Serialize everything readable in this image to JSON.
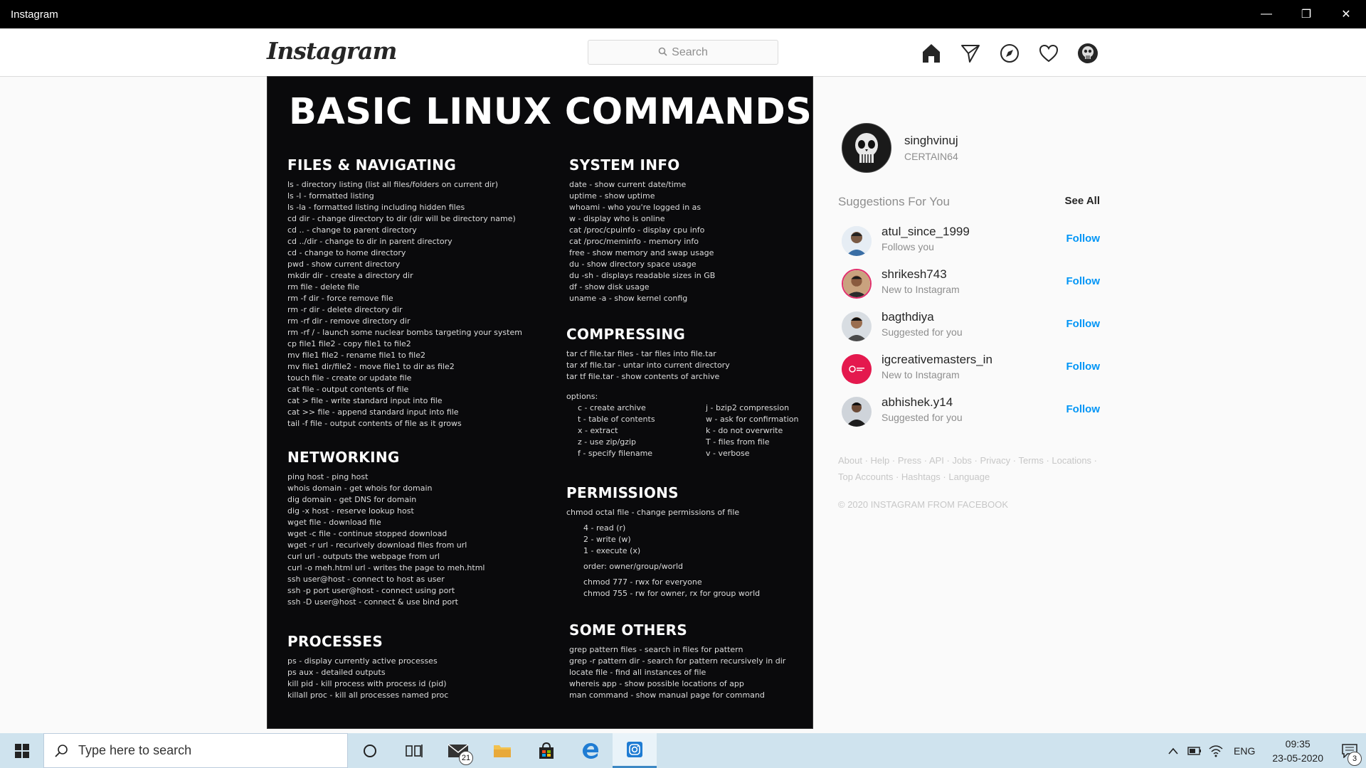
{
  "window": {
    "title": "Instagram",
    "minimize": "—",
    "restore": "❐",
    "close": "✕"
  },
  "header": {
    "logo": "Instagram",
    "search_placeholder": "Search"
  },
  "post": {
    "title": "BASIC LINUX COMMANDS",
    "sections": {
      "files": {
        "heading": "FILES & NAVIGATING",
        "lines": [
          "ls - directory listing (list all files/folders on current dir)",
          "ls -l - formatted listing",
          "ls -la - formatted listing including hidden files",
          "cd dir - change directory to dir (dir will be directory name)",
          "cd .. - change to parent directory",
          "cd ../dir - change to dir in parent directory",
          "cd - change to home directory",
          "pwd - show current directory",
          "mkdir dir - create a directory dir",
          "rm file - delete file",
          "rm -f dir - force remove file",
          "rm -r dir - delete directory dir",
          "rm -rf dir - remove directory dir",
          "rm -rf / - launch some nuclear bombs targeting your system",
          "cp file1 file2 - copy file1 to file2",
          "mv file1 file2 - rename file1 to file2",
          "mv file1 dir/file2 - move file1 to dir as file2",
          "touch file - create or update file",
          "cat file - output contents of file",
          "cat > file - write standard input into file",
          "cat >> file - append standard input into file",
          "tail -f file - output contents of file as it grows"
        ]
      },
      "networking": {
        "heading": "NETWORKING",
        "lines": [
          "ping host - ping host",
          "whois domain - get whois for domain",
          "dig domain - get DNS for domain",
          "dig -x host - reserve lookup host",
          "wget file - download file",
          "wget -c file - continue stopped download",
          "wget -r url - recurively download files from url",
          "curl url - outputs the webpage from url",
          "curl -o meh.html url - writes the page to meh.html",
          "ssh user@host - connect to host as user",
          "ssh -p port user@host - connect using port",
          "ssh -D user@host - connect & use bind port"
        ]
      },
      "processes": {
        "heading": "PROCESSES",
        "lines": [
          "ps - display currently active processes",
          "ps aux - detailed outputs",
          "kill pid - kill process with process id (pid)",
          "killall proc - kill all processes named proc"
        ]
      },
      "sysinfo": {
        "heading": "SYSTEM INFO",
        "lines": [
          "date - show current date/time",
          "uptime - show uptime",
          "whoami - who you're logged in as",
          "w - display who is online",
          "cat /proc/cpuinfo - display cpu info",
          "cat /proc/meminfo - memory info",
          "free - show memory and swap usage",
          "du - show directory space usage",
          "du -sh - displays readable sizes in GB",
          "df - show disk usage",
          "uname -a - show kernel config"
        ]
      },
      "compressing": {
        "heading": "COMPRESSING",
        "lines": [
          "tar cf file.tar files - tar files into file.tar",
          "tar xf file.tar - untar into current directory",
          "tar tf file.tar - show contents of archive"
        ],
        "options_label": "options:",
        "options_left": [
          "c - create archive",
          "t - table of contents",
          "x - extract",
          "z - use zip/gzip",
          "f - specify filename"
        ],
        "options_right": [
          "j - bzip2 compression",
          "w - ask for confirmation",
          "k - do not overwrite",
          "T - files from file",
          "v - verbose"
        ]
      },
      "permissions": {
        "heading": "PERMISSIONS",
        "lines": [
          "chmod octal file - change permissions of file"
        ],
        "octal": [
          "4 - read (r)",
          "2 - write (w)",
          "1 - execute (x)"
        ],
        "order": "order: owner/group/world",
        "examples": [
          "chmod 777 - rwx for everyone",
          "chmod 755 - rw for owner, rx for group world"
        ]
      },
      "others": {
        "heading": "SOME OTHERS",
        "lines": [
          "grep pattern files - search in files for pattern",
          "grep -r pattern dir - search for pattern recursively in dir",
          "locate file - find all instances of file",
          "whereis app - show possible locations of app",
          "man command - show manual page for command"
        ]
      }
    }
  },
  "sidebar": {
    "username": "singhvinuj",
    "fullname": "CERTAIN64",
    "suggestions_title": "Suggestions For You",
    "see_all": "See All",
    "suggestions": [
      {
        "user": "atul_since_1999",
        "reason": "Follows you",
        "action": "Follow"
      },
      {
        "user": "shrikesh743",
        "reason": "New to Instagram",
        "action": "Follow"
      },
      {
        "user": "bagthdiya",
        "reason": "Suggested for you",
        "action": "Follow"
      },
      {
        "user": "igcreativemasters_in",
        "reason": "New to Instagram",
        "action": "Follow"
      },
      {
        "user": "abhishek.y14",
        "reason": "Suggested for you",
        "action": "Follow"
      }
    ],
    "footer_links": [
      "About",
      "Help",
      "Press",
      "API",
      "Jobs",
      "Privacy",
      "Terms",
      "Locations",
      "Top Accounts",
      "Hashtags",
      "Language"
    ],
    "copyright": "© 2020 INSTAGRAM FROM FACEBOOK"
  },
  "taskbar": {
    "search_placeholder": "Type here to search",
    "mail_badge": "21",
    "lang": "ENG",
    "time": "09:35",
    "date": "23-05-2020",
    "notif_badge": "3"
  },
  "colors": {
    "link_blue": "#0095f6",
    "taskbar": "#cfe3ee",
    "post_bg": "#0a0a0c"
  }
}
